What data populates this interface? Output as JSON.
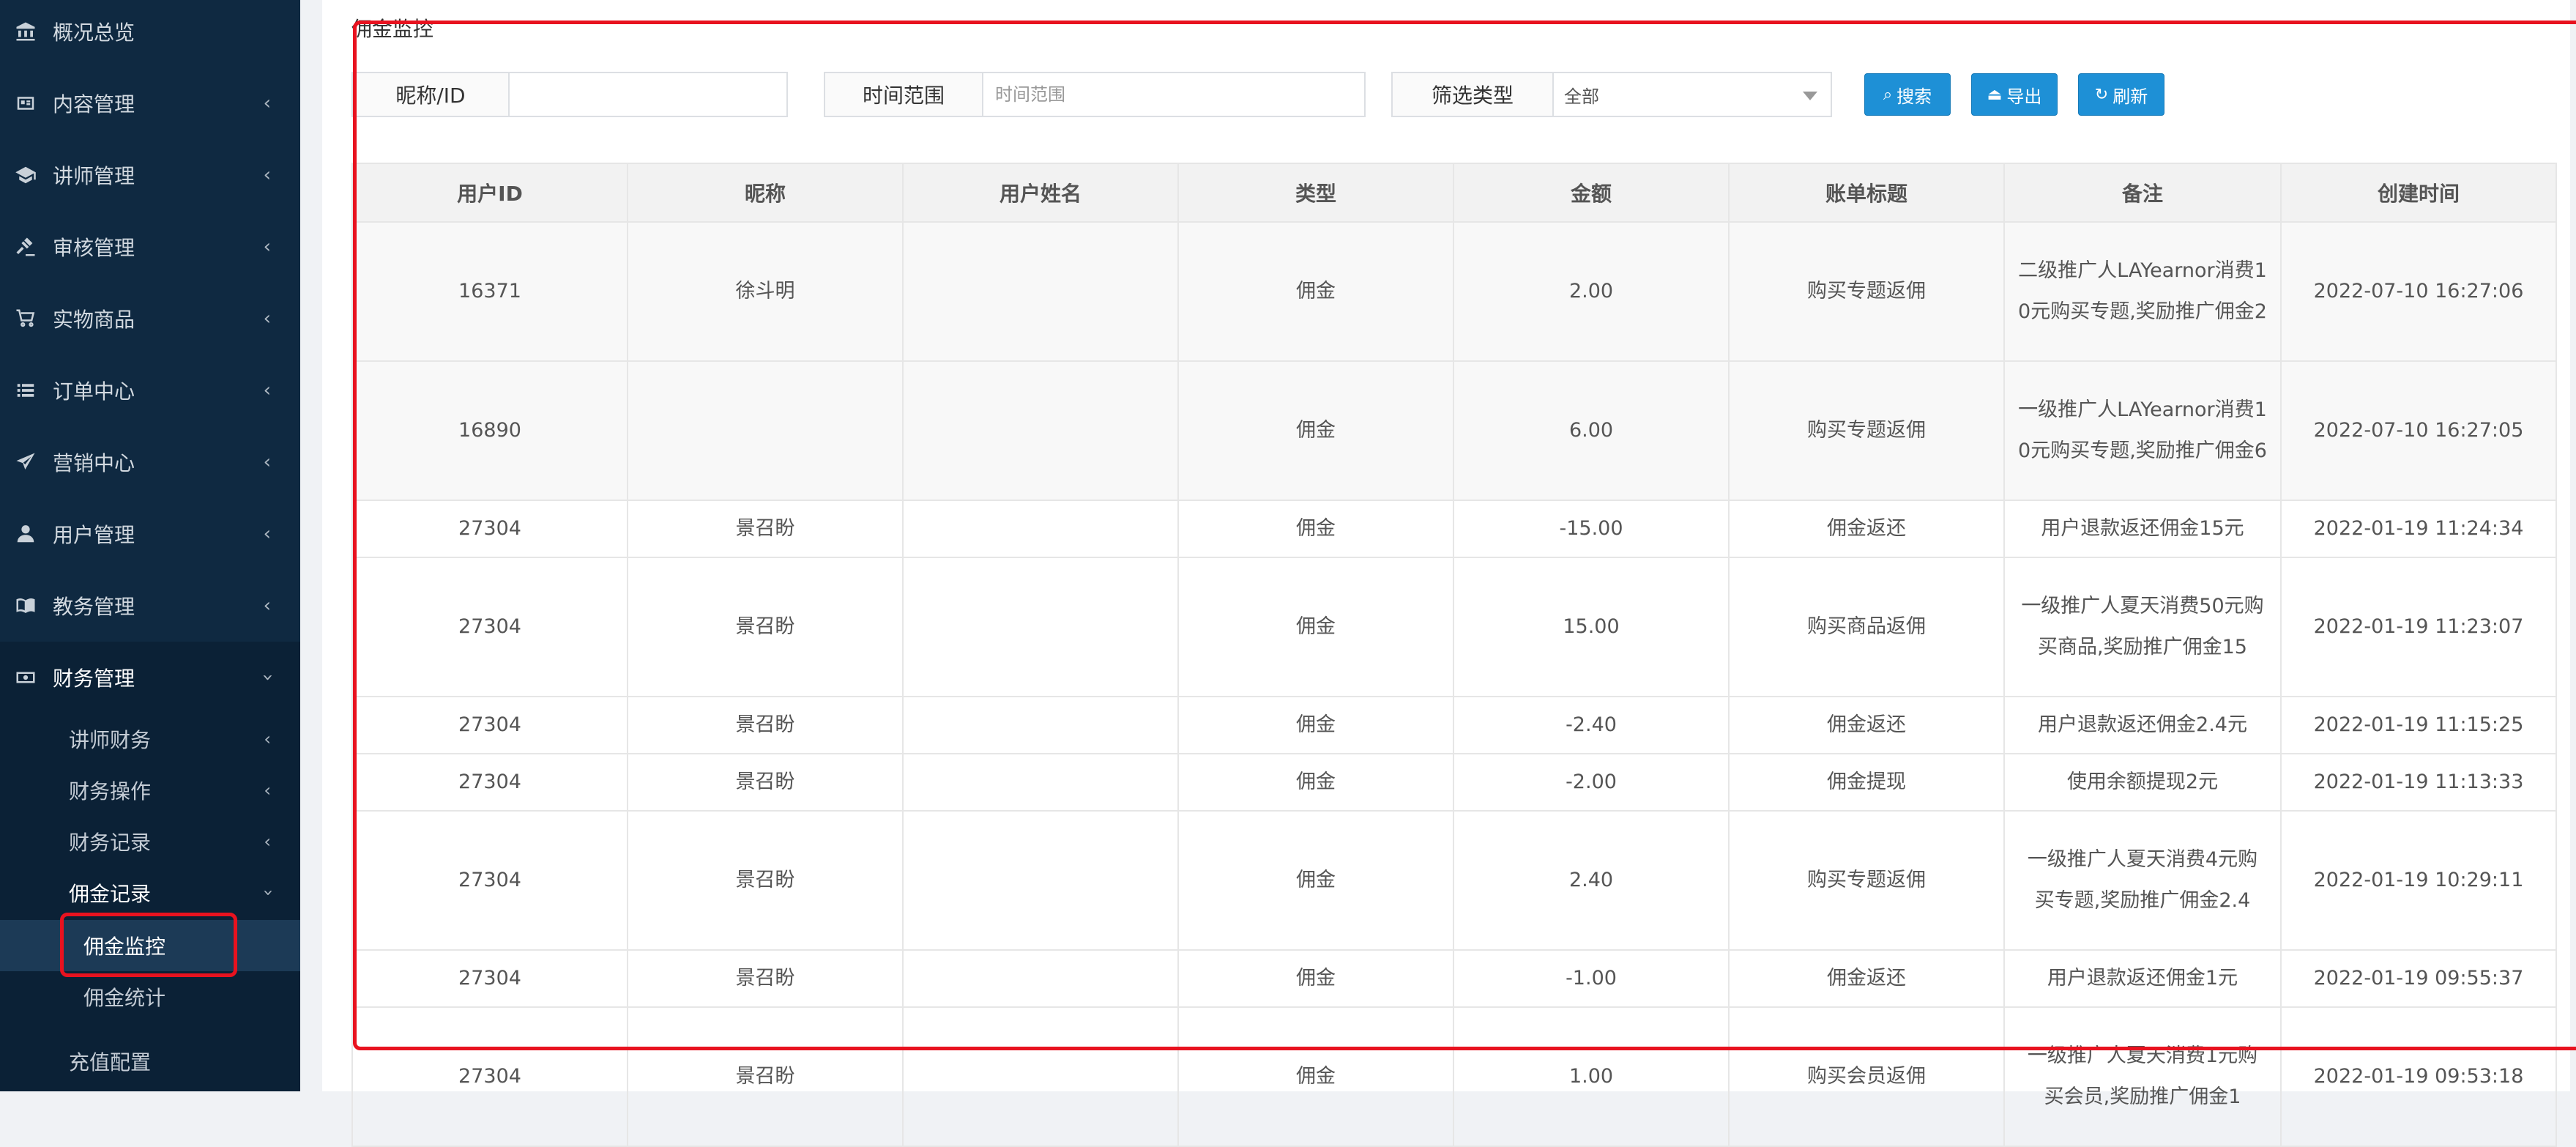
{
  "sidebar": {
    "items": [
      {
        "label": "概况总览",
        "icon": "bank-icon",
        "has_chevron": false
      },
      {
        "label": "内容管理",
        "icon": "newspaper-icon",
        "has_chevron": true
      },
      {
        "label": "讲师管理",
        "icon": "graduation-cap-icon",
        "has_chevron": true
      },
      {
        "label": "审核管理",
        "icon": "gavel-icon",
        "has_chevron": true
      },
      {
        "label": "实物商品",
        "icon": "cart-icon",
        "has_chevron": true
      },
      {
        "label": "订单中心",
        "icon": "list-icon",
        "has_chevron": true
      },
      {
        "label": "营销中心",
        "icon": "send-icon",
        "has_chevron": true
      },
      {
        "label": "用户管理",
        "icon": "user-icon",
        "has_chevron": true
      },
      {
        "label": "教务管理",
        "icon": "book-icon",
        "has_chevron": true
      },
      {
        "label": "财务管理",
        "icon": "money-icon",
        "has_chevron": true,
        "expanded": true
      }
    ],
    "finance_sub": [
      {
        "label": "讲师财务"
      },
      {
        "label": "财务操作"
      },
      {
        "label": "财务记录"
      },
      {
        "label": "佣金记录",
        "expanded": true
      }
    ],
    "commission_sub": [
      {
        "label": "佣金监控",
        "active": true
      },
      {
        "label": "佣金统计"
      }
    ],
    "recharge": {
      "label": "充值配置"
    }
  },
  "panel": {
    "title": "佣金监控"
  },
  "filters": {
    "nickname_label": "昵称/ID",
    "nickname_value": "",
    "time_label": "时间范围",
    "time_placeholder": "时间范围",
    "type_label": "筛选类型",
    "type_value": "全部",
    "search_button": "搜索",
    "export_button": "导出",
    "refresh_button": "刷新"
  },
  "table": {
    "headers": [
      "用户ID",
      "昵称",
      "用户姓名",
      "类型",
      "金额",
      "账单标题",
      "备注",
      "创建时间"
    ],
    "rows": [
      {
        "id": "16371",
        "nickname": "徐斗明",
        "name": "",
        "type": "佣金",
        "amount": "2.00",
        "sign": "pos",
        "title": "购买专题返佣",
        "note": "二级推广人LAYearnor消费10元购买专题,奖励推广佣金2",
        "time": "2022-07-10 16:27:06"
      },
      {
        "id": "16890",
        "nickname": "",
        "name": "",
        "type": "佣金",
        "amount": "6.00",
        "sign": "pos",
        "title": "购买专题返佣",
        "note": "一级推广人LAYearnor消费10元购买专题,奖励推广佣金6",
        "time": "2022-07-10 16:27:05"
      },
      {
        "id": "27304",
        "nickname": "景召盼",
        "name": "",
        "type": "佣金",
        "amount": "-15.00",
        "sign": "neg",
        "title": "佣金返还",
        "note": "用户退款返还佣金15元",
        "time": "2022-01-19 11:24:34"
      },
      {
        "id": "27304",
        "nickname": "景召盼",
        "name": "",
        "type": "佣金",
        "amount": "15.00",
        "sign": "pos",
        "title": "购买商品返佣",
        "note": "一级推广人夏天消费50元购买商品,奖励推广佣金15",
        "time": "2022-01-19 11:23:07"
      },
      {
        "id": "27304",
        "nickname": "景召盼",
        "name": "",
        "type": "佣金",
        "amount": "-2.40",
        "sign": "neg",
        "title": "佣金返还",
        "note": "用户退款返还佣金2.4元",
        "time": "2022-01-19 11:15:25"
      },
      {
        "id": "27304",
        "nickname": "景召盼",
        "name": "",
        "type": "佣金",
        "amount": "-2.00",
        "sign": "neg",
        "title": "佣金提现",
        "note": "使用余额提现2元",
        "time": "2022-01-19 11:13:33"
      },
      {
        "id": "27304",
        "nickname": "景召盼",
        "name": "",
        "type": "佣金",
        "amount": "2.40",
        "sign": "pos",
        "title": "购买专题返佣",
        "note": "一级推广人夏天消费4元购买专题,奖励推广佣金2.4",
        "time": "2022-01-19 10:29:11"
      },
      {
        "id": "27304",
        "nickname": "景召盼",
        "name": "",
        "type": "佣金",
        "amount": "-1.00",
        "sign": "neg",
        "title": "佣金返还",
        "note": "用户退款返还佣金1元",
        "time": "2022-01-19 09:55:37"
      },
      {
        "id": "27304",
        "nickname": "景召盼",
        "name": "",
        "type": "佣金",
        "amount": "1.00",
        "sign": "pos",
        "title": "购买会员返佣",
        "note": "一级推广人夏天消费1元购买会员,奖励推广佣金1",
        "time": "2022-01-19 09:53:18"
      }
    ]
  },
  "colors": {
    "sidebar_bg": "#0f2941",
    "accent": "#1e90d6",
    "highlight": "#e8121f",
    "positive": "#0f9b8e",
    "negative": "#f04b1e"
  }
}
